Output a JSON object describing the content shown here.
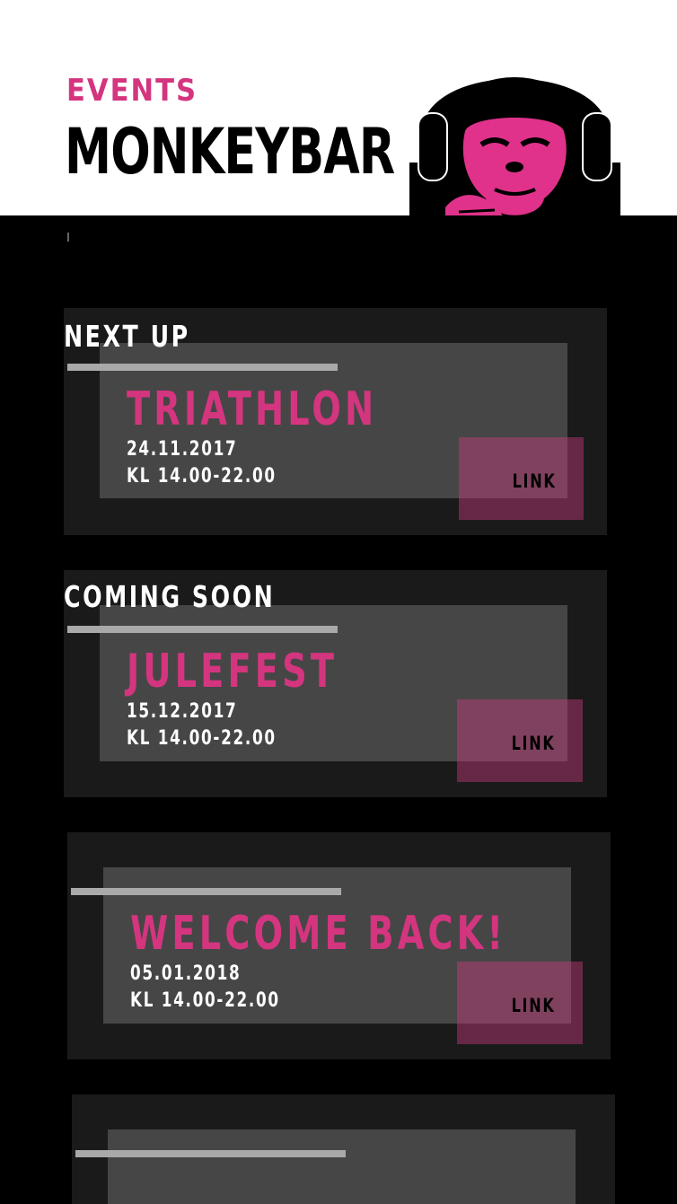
{
  "header": {
    "section": "EVENTS",
    "brand": "MONKEYBAR"
  },
  "colors": {
    "accent": "#d4357f",
    "background": "#000000",
    "card": "#1a1a1a",
    "card_inner": "#464646"
  },
  "events": [
    {
      "section_label": "NEXT UP",
      "title": "TRIATHLON",
      "date": "24.11.2017",
      "time": "KL 14.00-22.00",
      "link": "LINK"
    },
    {
      "section_label": "COMING SOON",
      "title": "JULEFEST",
      "date": "15.12.2017",
      "time": "KL 14.00-22.00",
      "link": "LINK"
    },
    {
      "section_label": "",
      "title": "WELCOME BACK!",
      "date": "05.01.2018",
      "time": "KL 14.00-22.00",
      "link": "LINK"
    }
  ],
  "logo_icon": "monkey-with-headphones-icon"
}
